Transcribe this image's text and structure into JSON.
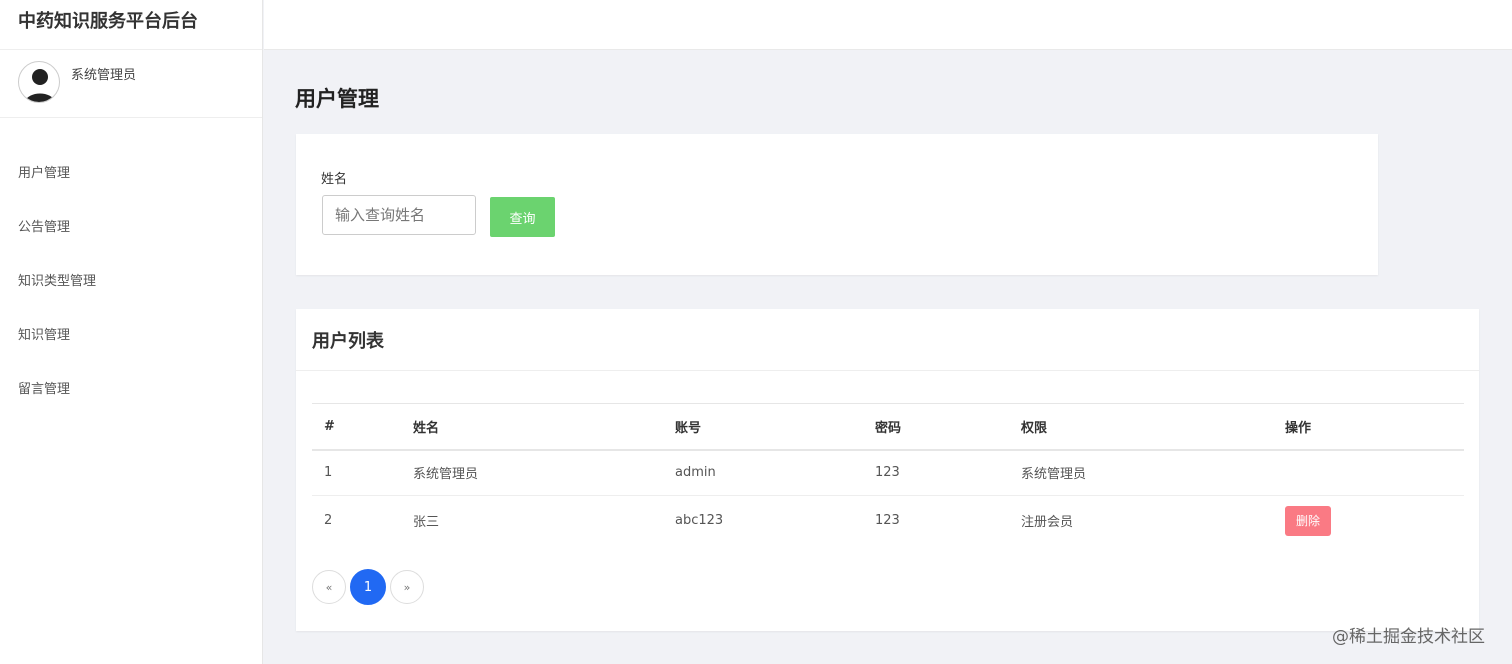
{
  "app": {
    "title": "中药知识服务平台后台"
  },
  "user": {
    "name": "系统管理员"
  },
  "nav": {
    "items": [
      {
        "label": "用户管理"
      },
      {
        "label": "公告管理"
      },
      {
        "label": "知识类型管理"
      },
      {
        "label": "知识管理"
      },
      {
        "label": "留言管理"
      }
    ]
  },
  "page": {
    "title": "用户管理"
  },
  "search": {
    "label": "姓名",
    "placeholder": "输入查询姓名",
    "value": "",
    "button_label": "查询"
  },
  "list": {
    "title": "用户列表",
    "columns": [
      "#",
      "姓名",
      "账号",
      "密码",
      "权限",
      "操作"
    ],
    "rows": [
      {
        "index": "1",
        "name": "系统管理员",
        "account": "admin",
        "password": "123",
        "role": "系统管理员",
        "action": ""
      },
      {
        "index": "2",
        "name": "张三",
        "account": "abc123",
        "password": "123",
        "role": "注册会员",
        "action": "删除"
      }
    ]
  },
  "pagination": {
    "prev": "«",
    "current": "1",
    "next": "»"
  },
  "watermark": "@稀土掘金技术社区",
  "colors": {
    "query_button": "#6bd36f",
    "delete_button": "#fa7a84",
    "active_page": "#2169f3"
  }
}
